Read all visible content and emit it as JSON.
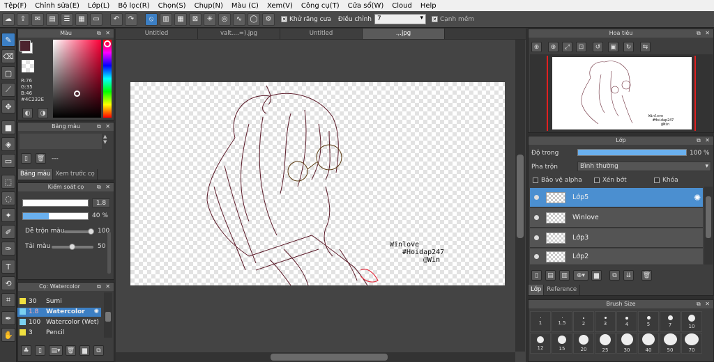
{
  "menu": [
    "Tệp(F)",
    "Chỉnh sửa(E)",
    "Lớp(L)",
    "Bộ lọc(R)",
    "Chọn(S)",
    "Chụp(N)",
    "Màu (C)",
    "Xem(V)",
    "Công cụ(T)",
    "Cửa sổ(W)",
    "Cloud",
    "Help"
  ],
  "toolbar": {
    "antialias_label": "Khử răng cưa",
    "adjust_label": "Điều chỉnh",
    "adjust_value": "7",
    "edge_label": "Cạnh mềm"
  },
  "doc_tabs": [
    "Untitled",
    "valt....=).jpg",
    "Untitled",
    ".,.jpg"
  ],
  "color_panel": {
    "title": "Màu",
    "r": "R:76",
    "g": "G:35",
    "b": "B:46",
    "hex": "#4C232E",
    "primary_color": "#4c232e"
  },
  "palette_panel": {
    "title": "Bảng màu",
    "dash": "---",
    "tabs": [
      "Bảng màu",
      "Xem trước cọ"
    ]
  },
  "brush_control": {
    "title": "Kiểm soát cọ",
    "size": "1.8",
    "opacity": "40 %",
    "opacity_fraction": 0.4,
    "blend_label": "Dễ trộn màu",
    "blend_value": "100",
    "blend_fraction": 1.0,
    "paint_label": "Tải màu",
    "paint_value": "50",
    "paint_fraction": 0.5
  },
  "brush_list": {
    "title": "Cọ: Watercolor",
    "items": [
      {
        "size": "30",
        "name": "Sumi",
        "color": "#f0e040"
      },
      {
        "size": "1.8",
        "name": "Watercolor",
        "color": "#7ad0f0",
        "selected": true
      },
      {
        "size": "100",
        "name": "Watercolor (Wet)",
        "color": "#7ad0f0"
      },
      {
        "size": "3",
        "name": "Pencil",
        "color": "#f0e040"
      }
    ]
  },
  "canvas_text": [
    "Winlove",
    "#Hoidap247",
    "@Win"
  ],
  "navigator": {
    "title": "Hoa tiêu"
  },
  "layer_panel": {
    "title": "Lớp",
    "opacity_label": "Độ trong",
    "opacity_value": "100 %",
    "opacity_fraction": 1.0,
    "blend_label": "Pha trộn",
    "blend_value": "Bình thường",
    "protect_alpha": "Bảo vệ alpha",
    "clipping": "Xén bớt",
    "lock": "Khóa",
    "layers": [
      {
        "name": "Lớp5",
        "selected": true
      },
      {
        "name": "Winlove",
        "selected": false
      },
      {
        "name": "Lớp3",
        "selected": false
      },
      {
        "name": "Lớp2",
        "selected": false
      }
    ],
    "tabs": [
      "Lớp",
      "Reference"
    ]
  },
  "brush_size": {
    "title": "Brush Size",
    "row1": [
      "1",
      "1.5",
      "2",
      "3",
      "4",
      "5",
      "7",
      "10"
    ],
    "row2": [
      "12",
      "15",
      "20",
      "25",
      "30",
      "40",
      "50",
      "70"
    ]
  }
}
